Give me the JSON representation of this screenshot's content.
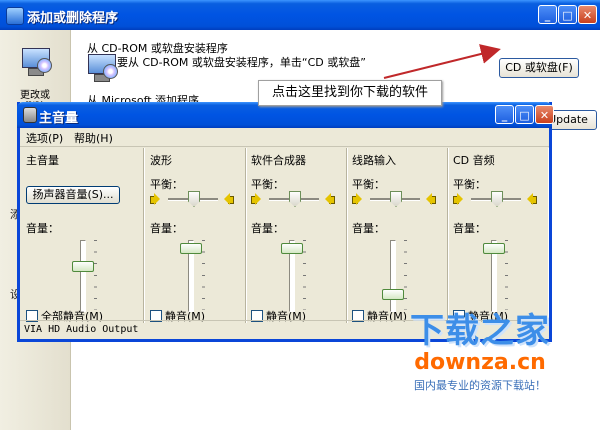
{
  "arp_window": {
    "title": "添加或删除程序",
    "sidebar": {
      "change_remove": "更改或\n删除\n程序",
      "glyph_a": "添",
      "glyph_b": "设"
    },
    "cd_heading": "从 CD-ROM 或软盘安装程序",
    "cd_desc": "要从 CD-ROM 或软盘安装程序，单击“CD 或软盘”",
    "cd_button": "CD 或软盘(F)",
    "ms_heading": "从 Microsoft 添加程序",
    "update_button": "Update"
  },
  "callout": {
    "text": "点击这里找到你下载的软件"
  },
  "volume_window": {
    "title": "主音量",
    "menu": [
      "选项(P)",
      "帮助(H)"
    ],
    "balance_label": "平衡：",
    "volume_label": "音量：",
    "master": {
      "title": "主音量",
      "speaker_button": "扬声器音量(S)...",
      "mute_label": "全部静音(M)"
    },
    "channels": [
      {
        "title": "波形",
        "mute_label": "静音(M)",
        "volume_level": 0.95,
        "balance": 0.5
      },
      {
        "title": "软件合成器",
        "mute_label": "静音(M)",
        "volume_level": 0.95,
        "balance": 0.5
      },
      {
        "title": "线路输入",
        "mute_label": "静音(M)",
        "volume_level": 0.2,
        "balance": 0.5
      },
      {
        "title": "CD 音频",
        "mute_label": "静音(M)",
        "volume_level": 0.95,
        "balance": 0.5
      }
    ],
    "master_volume_level": 0.65,
    "status": "VIA HD Audio Output"
  },
  "watermark": {
    "cn": "下载之家",
    "en": "downza.cn",
    "slogan": "国内最专业的资源下载站！"
  },
  "colors": {
    "titlebar": "#0054e3",
    "dialog_bg": "#ece9d8",
    "arrow": "#c0282a",
    "watermark_blue": "#3d8ee8",
    "watermark_orange": "#ff6a00"
  }
}
